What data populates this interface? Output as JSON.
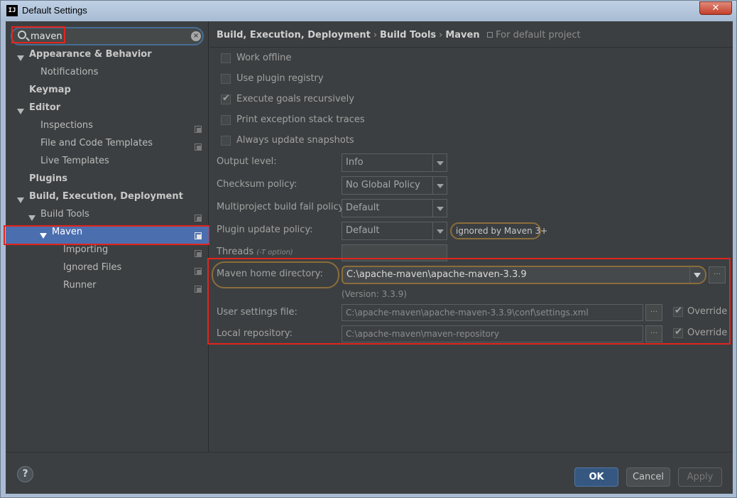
{
  "window": {
    "title": "Default Settings",
    "app_icon_text": "IJ",
    "close_glyph": "✕"
  },
  "search": {
    "value": "maven",
    "clear_glyph": "×"
  },
  "tree": [
    {
      "label": "Appearance & Behavior",
      "bold": true,
      "expanded": true
    },
    {
      "label": "Notifications"
    },
    {
      "label": "Keymap",
      "bold": true
    },
    {
      "label": "Editor",
      "bold": true,
      "expanded": true
    },
    {
      "label": "Inspections"
    },
    {
      "label": "File and Code Templates"
    },
    {
      "label": "Live Templates"
    },
    {
      "label": "Plugins",
      "bold": true
    },
    {
      "label": "Build, Execution, Deployment",
      "bold": true,
      "expanded": true
    },
    {
      "label": "Build Tools",
      "expanded": true
    },
    {
      "label": "Maven",
      "expanded": true,
      "selected": true
    },
    {
      "label": "Importing"
    },
    {
      "label": "Ignored Files"
    },
    {
      "label": "Runner"
    }
  ],
  "breadcrumb": {
    "parts": [
      "Build, Execution, Deployment",
      "Build Tools",
      "Maven"
    ],
    "separator": "›",
    "note": "For default project"
  },
  "checkboxes": [
    {
      "label": "Work offline",
      "checked": false
    },
    {
      "label": "Use plugin registry",
      "checked": false
    },
    {
      "label": "Execute goals recursively",
      "checked": true
    },
    {
      "label": "Print exception stack traces",
      "checked": false
    },
    {
      "label": "Always update snapshots",
      "checked": false
    }
  ],
  "fields": {
    "output_level": {
      "label": "Output level:",
      "value": "Info"
    },
    "checksum_policy": {
      "label": "Checksum policy:",
      "value": "No Global Policy"
    },
    "multiproject_fail": {
      "label": "Multiproject build fail policy:",
      "value": "Default"
    },
    "plugin_update": {
      "label": "Plugin update policy:",
      "value": "Default",
      "note": "ignored by Maven 3+"
    },
    "threads": {
      "label": "Threads",
      "hint": "(-T option)",
      "value": ""
    },
    "maven_home": {
      "label": "Maven home directory:",
      "value": "C:\\apache-maven\\apache-maven-3.3.9",
      "version": "(Version: 3.3.9)"
    },
    "user_settings": {
      "label": "User settings file:",
      "value": "C:\\apache-maven\\apache-maven-3.3.9\\conf\\settings.xml",
      "override": "Override"
    },
    "local_repo": {
      "label": "Local repository:",
      "value": "C:\\apache-maven\\maven-repository",
      "override": "Override"
    }
  },
  "ellipsis": "···",
  "buttons": {
    "ok": "OK",
    "cancel": "Cancel",
    "apply": "Apply",
    "help": "?"
  },
  "colors": {
    "selection": "#4b6eaf",
    "highlight_red": "#e2241d",
    "highlight_gold": "#8a6d3b"
  }
}
